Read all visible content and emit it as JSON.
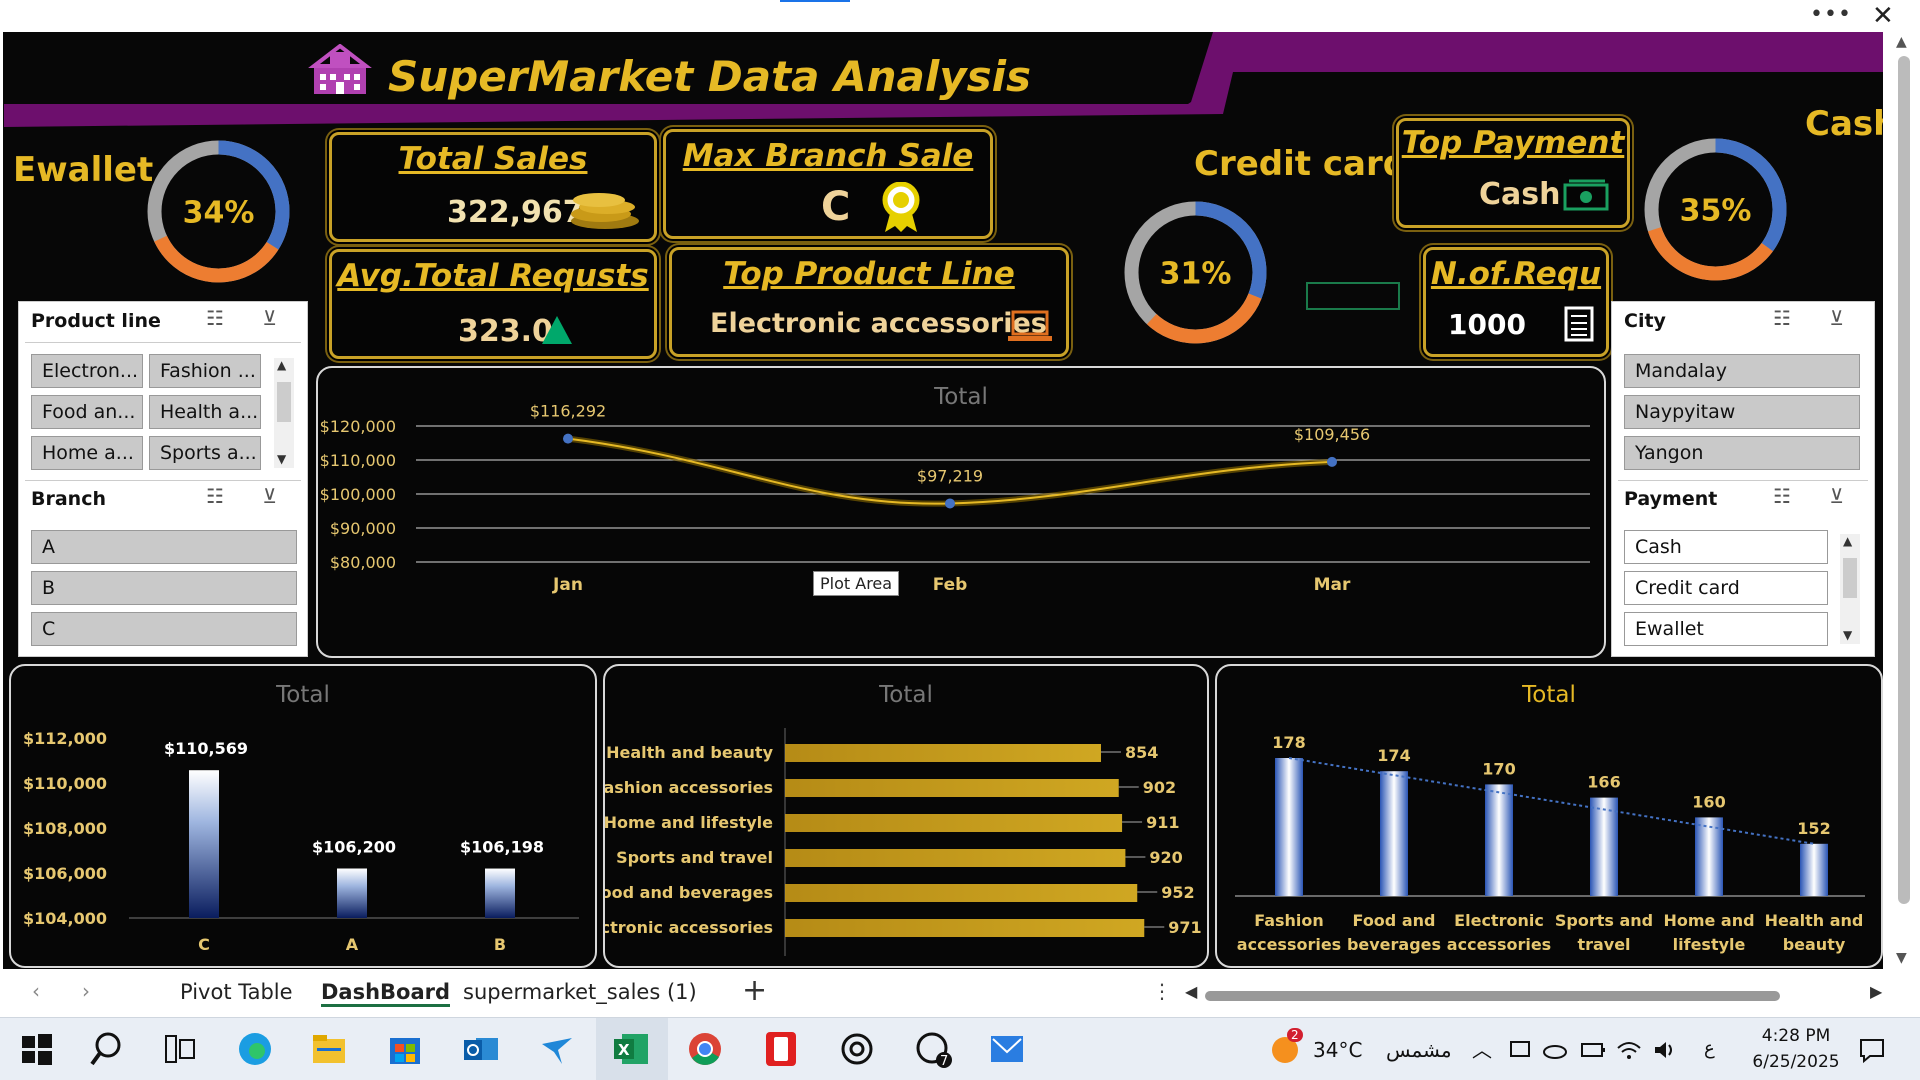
{
  "window": {
    "more_label": "•••",
    "close_label": "✕"
  },
  "dashboard": {
    "title": "SuperMarket Data Analysis",
    "header_icon": "bank-building-icon",
    "colors": {
      "gold": "#e6b925",
      "purple": "#6d0f6d",
      "blue": "#4472c4",
      "orange": "#ed7d31",
      "gray": "#a5a5a5",
      "navy": "#0a1d5e"
    },
    "kpis": {
      "total_sales": {
        "label": "Total Sales",
        "value": "322,967",
        "icon": "gold-coins-icon"
      },
      "max_branch": {
        "label": "Max Branch Sale",
        "value": "C",
        "icon": "award-ribbon-icon"
      },
      "avg_requests": {
        "label": "Avg.Total Requsts",
        "value": "323.0",
        "icon": "triangle-up-icon"
      },
      "top_product": {
        "label": "Top Product Line",
        "value": "Electronic accessories",
        "icon": "laptop-icon"
      },
      "top_payment": {
        "label": "Top Payment",
        "value": "Cash",
        "icon": "money-icon"
      },
      "n_requests": {
        "label": "N.of.Requ",
        "value": "1000",
        "icon": "calculator-icon"
      }
    },
    "donuts": [
      {
        "label": "Ewallet",
        "percent_label": "34%",
        "percent": 34
      },
      {
        "label": "Credit card",
        "percent_label": "31%",
        "percent": 31
      },
      {
        "label": "Cash",
        "percent_label": "35%",
        "percent": 35
      }
    ],
    "slicers": {
      "product_line": {
        "title": "Product line",
        "items": [
          "Electron...",
          "Fashion ...",
          "Food an...",
          "Health a...",
          "Home a...",
          "Sports a..."
        ]
      },
      "branch": {
        "title": "Branch",
        "items": [
          "A",
          "B",
          "C"
        ]
      },
      "city": {
        "title": "City",
        "items": [
          "Mandalay",
          "Naypyitaw",
          "Yangon"
        ]
      },
      "payment": {
        "title": "Payment",
        "items": [
          "Cash",
          "Credit card",
          "Ewallet"
        ]
      }
    },
    "tooltip": "Plot Area"
  },
  "chart_data": [
    {
      "type": "line",
      "title": "Total",
      "categories": [
        "Jan",
        "Feb",
        "Mar"
      ],
      "values": [
        116292,
        97219,
        109456
      ],
      "data_labels": [
        "$116,292",
        "$97,219",
        "$109,456"
      ],
      "yticks": [
        "$80,000",
        "$90,000",
        "$100,000",
        "$110,000",
        "$120,000"
      ],
      "ylim": [
        80000,
        120000
      ]
    },
    {
      "type": "bar",
      "title": "Total",
      "categories": [
        "C",
        "A",
        "B"
      ],
      "values": [
        110569,
        106200,
        106198
      ],
      "data_labels": [
        "$110,569",
        "$106,200",
        "$106,198"
      ],
      "yticks": [
        "$104,000",
        "$106,000",
        "$108,000",
        "$110,000",
        "$112,000"
      ],
      "ylim": [
        104000,
        112000
      ]
    },
    {
      "type": "bar",
      "orientation": "horizontal",
      "title": "Total",
      "categories": [
        "Health and beauty",
        "Fashion accessories",
        "Home and lifestyle",
        "Sports and travel",
        "Food and beverages",
        "Electronic accessories"
      ],
      "values": [
        854,
        902,
        911,
        920,
        952,
        971
      ],
      "data_labels": [
        "854",
        "902",
        "911",
        "920",
        "952",
        "971"
      ]
    },
    {
      "type": "bar",
      "title": "Total",
      "categories": [
        "Fashion accessories",
        "Food and beverages",
        "Electronic accessories",
        "Sports and travel",
        "Home and lifestyle",
        "Health and beauty"
      ],
      "category_lines": [
        [
          "Fashion",
          "accessories"
        ],
        [
          "Food and",
          "beverages"
        ],
        [
          "Electronic",
          "accessories"
        ],
        [
          "Sports and",
          "travel"
        ],
        [
          "Home and",
          "lifestyle"
        ],
        [
          "Health and",
          "beauty"
        ]
      ],
      "values": [
        178,
        174,
        170,
        166,
        160,
        152
      ],
      "data_labels": [
        "178",
        "174",
        "170",
        "166",
        "160",
        "152"
      ],
      "trendline": "linear"
    }
  ],
  "sheet_tabs": {
    "prev": "‹",
    "next": "›",
    "tabs": [
      "Pivot Table",
      "DashBoard",
      "supermarket_sales (1)"
    ],
    "active": "DashBoard",
    "add": "+",
    "more": "⋮"
  },
  "taskbar": {
    "weather_temp": "34°C",
    "weather_text": "مشمس",
    "weather_badge": "2",
    "time": "4:28 PM",
    "date": "6/25/2025",
    "lang": "ع",
    "whatsapp_badge": "7"
  }
}
